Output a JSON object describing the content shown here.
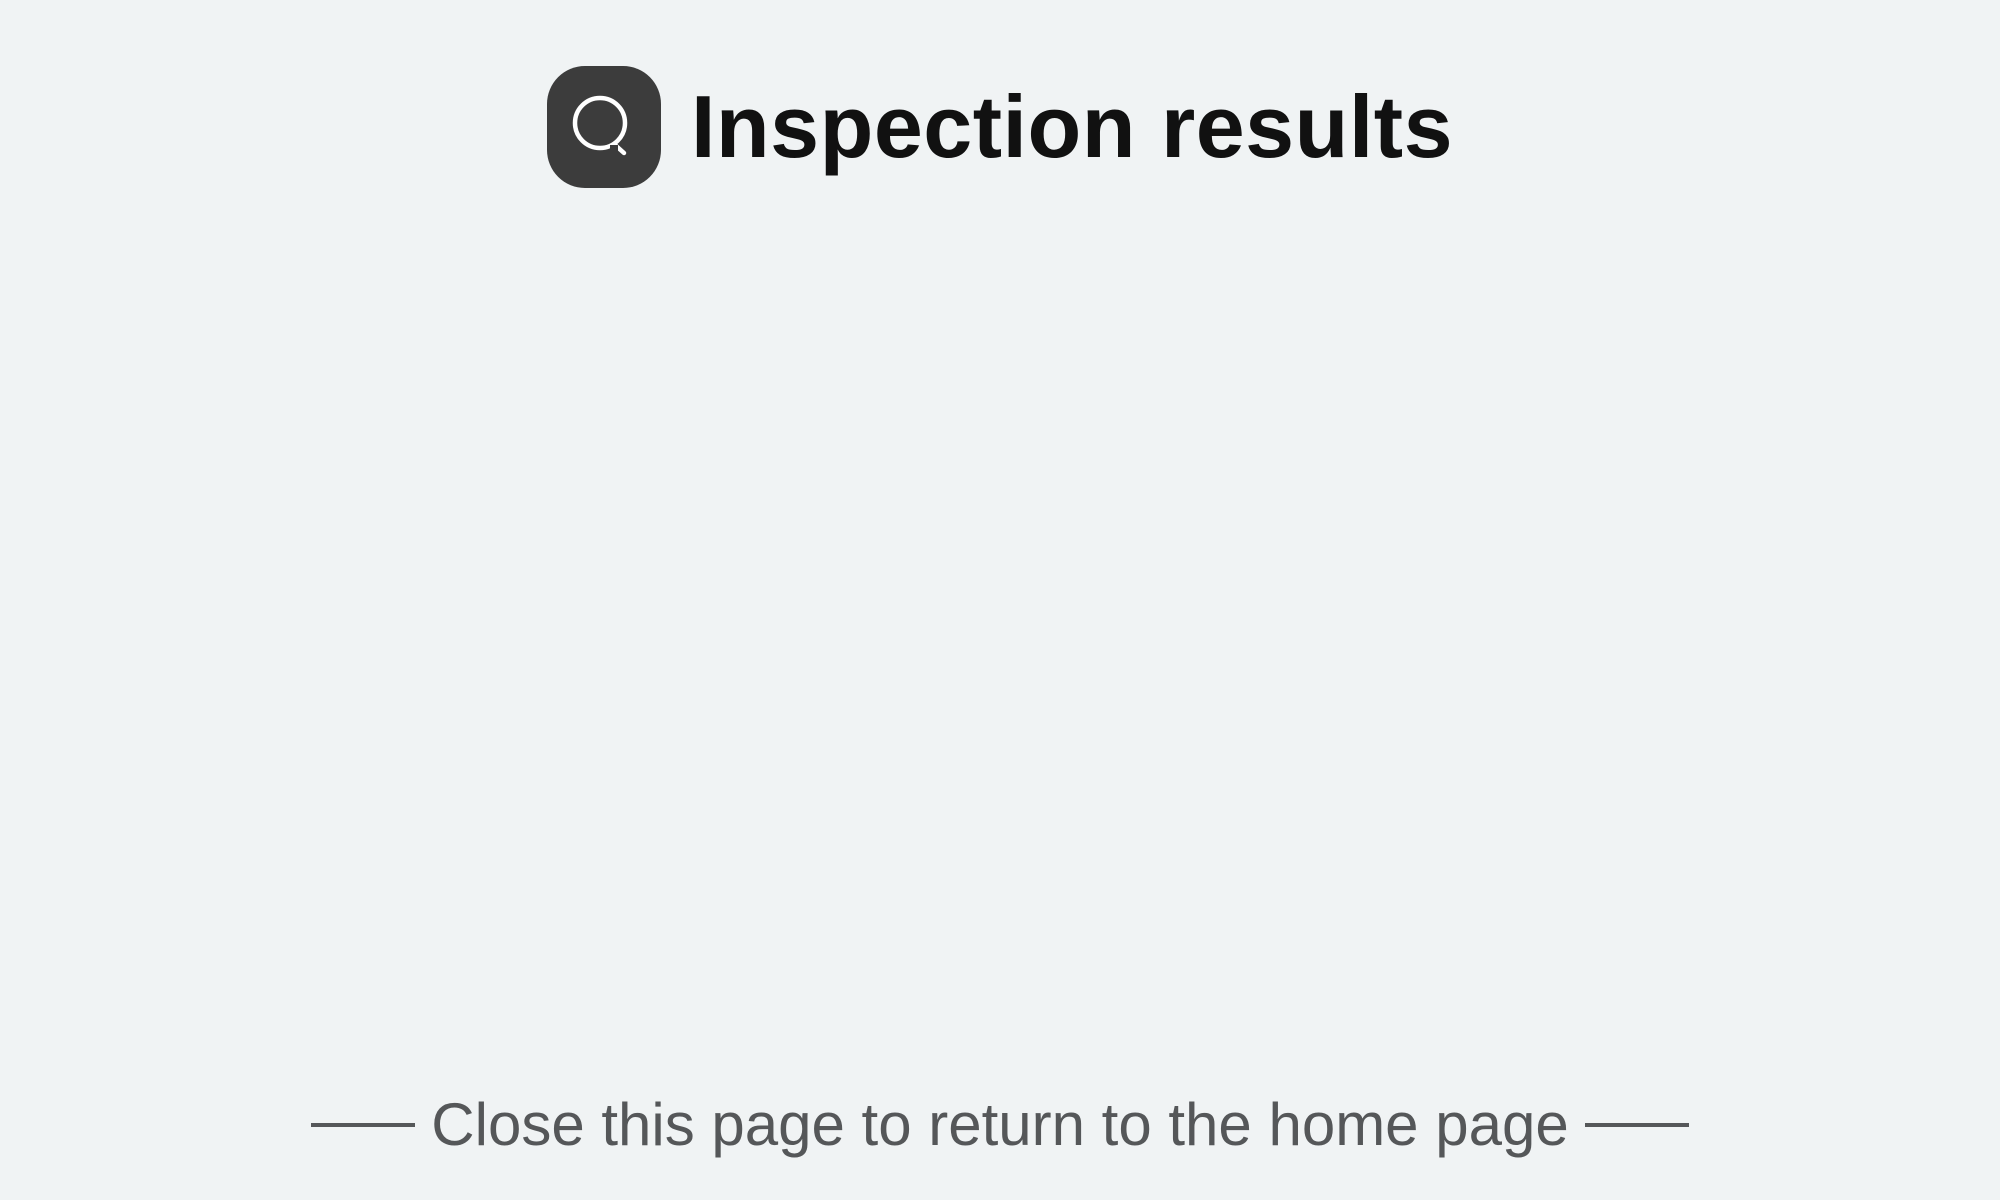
{
  "header": {
    "icon": "search-icon",
    "title": "Inspection results"
  },
  "footer": {
    "message": "Close this page to return to the home page"
  },
  "colors": {
    "background": "#f0f3f4",
    "icon_tile": "#3c3c3c",
    "title_text": "#111111",
    "footer_text": "#555759"
  }
}
